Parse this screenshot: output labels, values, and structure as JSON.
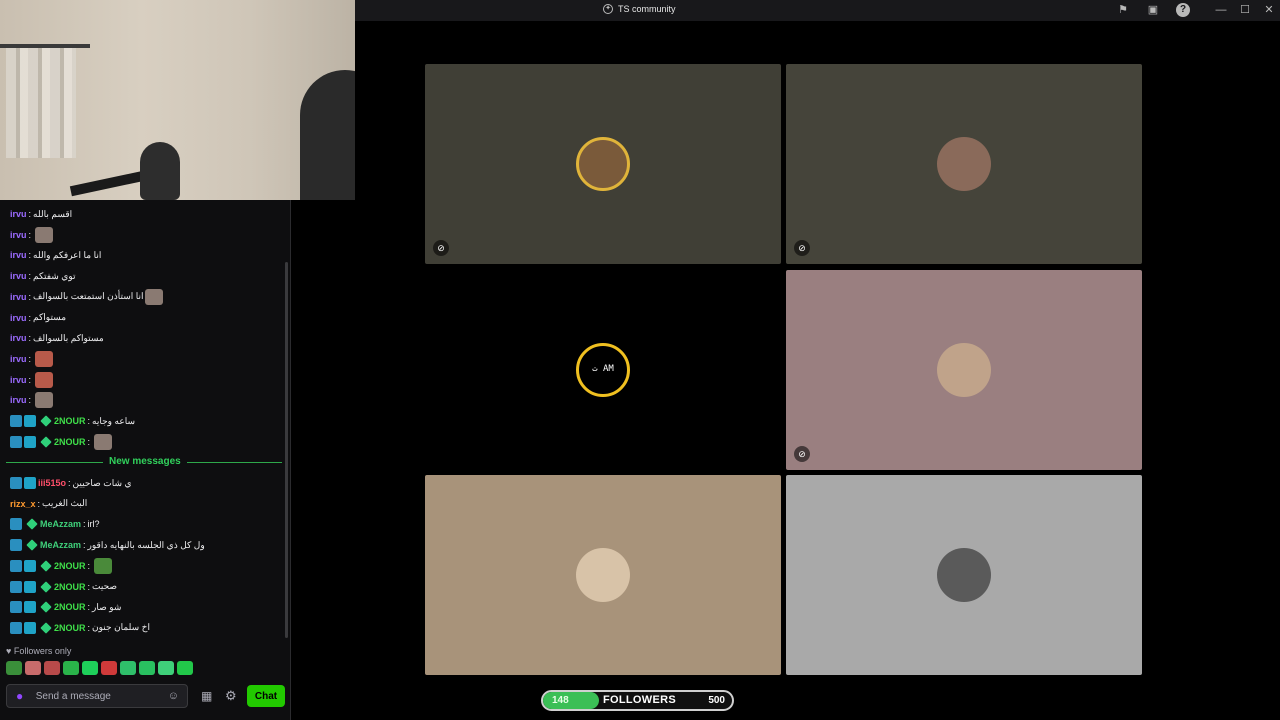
{
  "window": {
    "title": "TS community",
    "controls": [
      "flag-icon",
      "screen-icon",
      "help-icon",
      "minimize",
      "maximize",
      "close"
    ]
  },
  "chat": {
    "messages": [
      {
        "user": "irvu",
        "user_color": "#9b6bff",
        "badges": [],
        "text": "اقسم بالله",
        "emote": null
      },
      {
        "user": "irvu",
        "user_color": "#9b6bff",
        "badges": [],
        "text": "",
        "emote": "cat-emote"
      },
      {
        "user": "irvu",
        "user_color": "#9b6bff",
        "badges": [],
        "text": "انا ما اعرفكم والله",
        "emote": null
      },
      {
        "user": "irvu",
        "user_color": "#9b6bff",
        "badges": [],
        "text": "توي شفتكم",
        "emote": null
      },
      {
        "user": "irvu",
        "user_color": "#9b6bff",
        "badges": [],
        "text": "انا استأذن استمتعت بالسوالف",
        "emote": "face-emote"
      },
      {
        "user": "irvu",
        "user_color": "#9b6bff",
        "badges": [],
        "text": "مستواكم",
        "emote": null
      },
      {
        "user": "irvu",
        "user_color": "#9b6bff",
        "badges": [],
        "text": "مستواكم بالسوالف",
        "emote": null
      },
      {
        "user": "irvu",
        "user_color": "#9b6bff",
        "badges": [],
        "text": "",
        "emote": "red-face-emote"
      },
      {
        "user": "irvu",
        "user_color": "#9b6bff",
        "badges": [],
        "text": "",
        "emote": "red-face-emote"
      },
      {
        "user": "irvu",
        "user_color": "#9b6bff",
        "badges": [],
        "text": "",
        "emote": "man-emote"
      },
      {
        "user": "2NOUR",
        "user_color": "#3fe04a",
        "badges": [
          "b1",
          "b2",
          "b3"
        ],
        "text": "ساعه وجايه",
        "emote": null
      },
      {
        "user": "2NOUR",
        "user_color": "#3fe04a",
        "badges": [
          "b1",
          "b2",
          "b3"
        ],
        "text": "",
        "emote": "dog-emote"
      }
    ],
    "separator": "New messages",
    "new_messages": [
      {
        "user": "iii515o",
        "user_color": "#ff4f6a",
        "badges": [
          "b1",
          "b2"
        ],
        "text": "ي شات صاحيين",
        "emote": null
      },
      {
        "user": "rizx_x",
        "user_color": "#ff9a2f",
        "badges": [],
        "text": "البث الغريب",
        "emote": null
      },
      {
        "user": "MeAzzam",
        "user_color": "#3fd07a",
        "badges": [
          "b1",
          "b3"
        ],
        "text": "irl?",
        "emote": null
      },
      {
        "user": "MeAzzam",
        "user_color": "#3fd07a",
        "badges": [
          "b1",
          "b3"
        ],
        "text": "ول كل ذي الجلسه بالنهايه داقور",
        "emote": null
      },
      {
        "user": "2NOUR",
        "user_color": "#3fe04a",
        "badges": [
          "b1",
          "b2",
          "b3"
        ],
        "text": "",
        "emote": "frog-emote"
      },
      {
        "user": "2NOUR",
        "user_color": "#3fe04a",
        "badges": [
          "b1",
          "b2",
          "b3"
        ],
        "text": "صحيت",
        "emote": null
      },
      {
        "user": "2NOUR",
        "user_color": "#3fe04a",
        "badges": [
          "b1",
          "b2",
          "b3"
        ],
        "text": "شو صار",
        "emote": null
      },
      {
        "user": "2NOUR",
        "user_color": "#3fe04a",
        "badges": [
          "b1",
          "b2",
          "b3"
        ],
        "text": "اخ سلمان جنون",
        "emote": null
      }
    ],
    "followers_only": "Followers only",
    "emote_bar": [
      "#3a8f3a",
      "#c86b6b",
      "#b84a4a",
      "#2ab34a",
      "#1ecf5a",
      "#d03a3a",
      "#2fbf6a",
      "#29c060",
      "#3fd07a",
      "#22c84a"
    ],
    "input_placeholder": "Send a message",
    "chat_button": "Chat",
    "accent": "#22c900"
  },
  "tiles": [
    {
      "name": "participant-1",
      "bg": "#403f36",
      "avatar": "#7a5a3a",
      "ring": "#e0b43a",
      "muted": true
    },
    {
      "name": "participant-2",
      "bg": "#45443a",
      "avatar": "#8a6a5a",
      "ring": null,
      "muted": true
    },
    {
      "name": "participant-3",
      "bg": "#000000",
      "avatar": "#000000",
      "ring": "#f0c020",
      "muted": false,
      "avatar_text": "ت AM"
    },
    {
      "name": "participant-4",
      "bg": "#9a7f80",
      "avatar": "#c0a38a",
      "ring": null,
      "muted": true
    },
    {
      "name": "participant-5",
      "bg": "#a8937a",
      "avatar": "#d8c3a8",
      "ring": null,
      "muted": false
    },
    {
      "name": "participant-6",
      "bg": "#a9a9a9",
      "avatar": "#5a5a5a",
      "ring": null,
      "muted": false
    }
  ],
  "followers_goal": {
    "current": "148",
    "label": "FOLLOWERS",
    "goal": "500",
    "progress": 0.296,
    "fill_color": "#3bbf56"
  }
}
